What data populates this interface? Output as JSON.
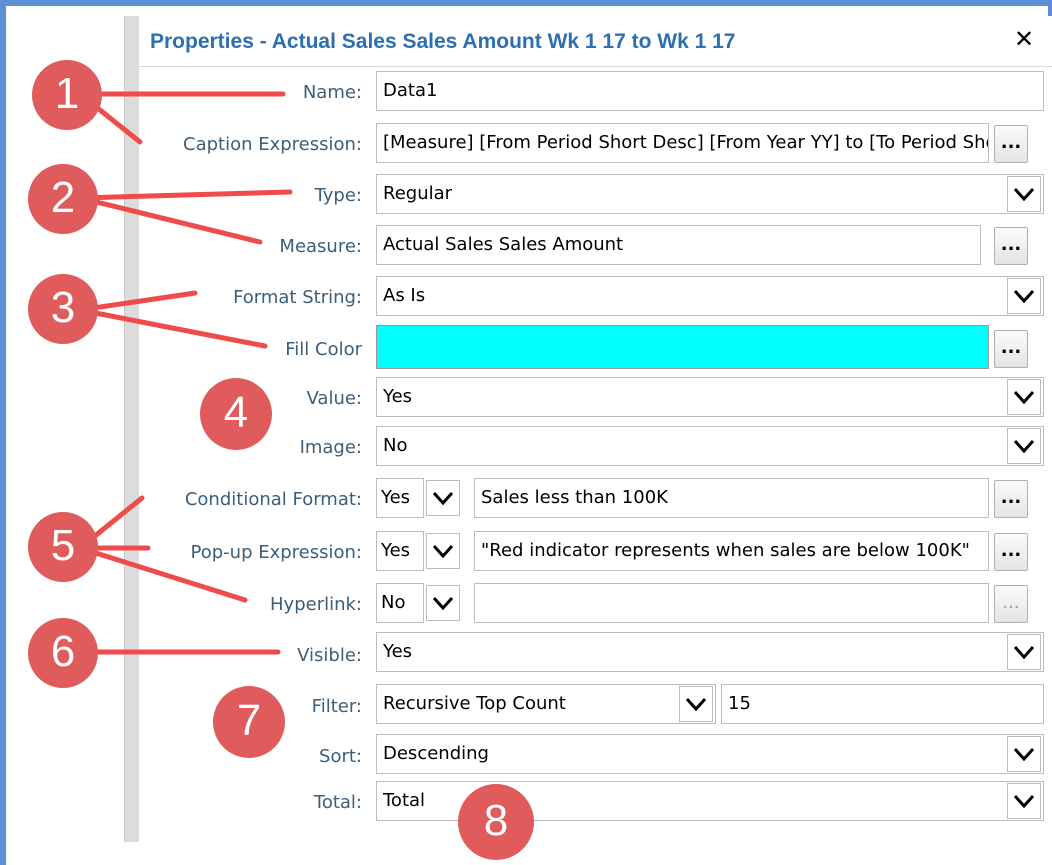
{
  "dialog": {
    "title": "Properties - Actual Sales Sales Amount Wk 1 17 to Wk 1 17",
    "close_label": "✕"
  },
  "fields": {
    "name": {
      "label": "Name:",
      "value": "Data1"
    },
    "caption_expression": {
      "label": "Caption Expression:",
      "value": "[Measure] [From Period Short Desc] [From Year YY] to [To Period Short Desc] [To Year YY]",
      "button": "..."
    },
    "type": {
      "label": "Type:",
      "value": "Regular"
    },
    "measure": {
      "label": "Measure:",
      "value": "Actual Sales Sales Amount",
      "button": "..."
    },
    "format_string": {
      "label": "Format String:",
      "value": "As Is"
    },
    "fill_color": {
      "label": "Fill Color",
      "color": "#00ffff",
      "button": "..."
    },
    "value": {
      "label": "Value:",
      "value": "Yes"
    },
    "image": {
      "label": "Image:",
      "value": "No"
    },
    "conditional_format": {
      "label": "Conditional Format:",
      "toggle": "Yes",
      "value": "Sales less than 100K",
      "button": "..."
    },
    "popup_expression": {
      "label": "Pop-up Expression:",
      "toggle": "Yes",
      "value": "\"Red indicator represents when sales are below 100K\"",
      "button": "..."
    },
    "hyperlink": {
      "label": "Hyperlink:",
      "toggle": "No",
      "value": "",
      "button": "..."
    },
    "visible": {
      "label": "Visible:",
      "value": "Yes"
    },
    "filter": {
      "label": "Filter:",
      "value": "Recursive Top Count",
      "count": "15"
    },
    "sort": {
      "label": "Sort:",
      "value": "Descending"
    },
    "total": {
      "label": "Total:",
      "value": "Total"
    }
  },
  "callouts": [
    "1",
    "2",
    "3",
    "4",
    "5",
    "6",
    "7",
    "8"
  ],
  "colors": {
    "callout": "#e05c5c",
    "title": "#2e6fb0",
    "label": "#3b5e7a",
    "frame": "#5b8fd6"
  }
}
